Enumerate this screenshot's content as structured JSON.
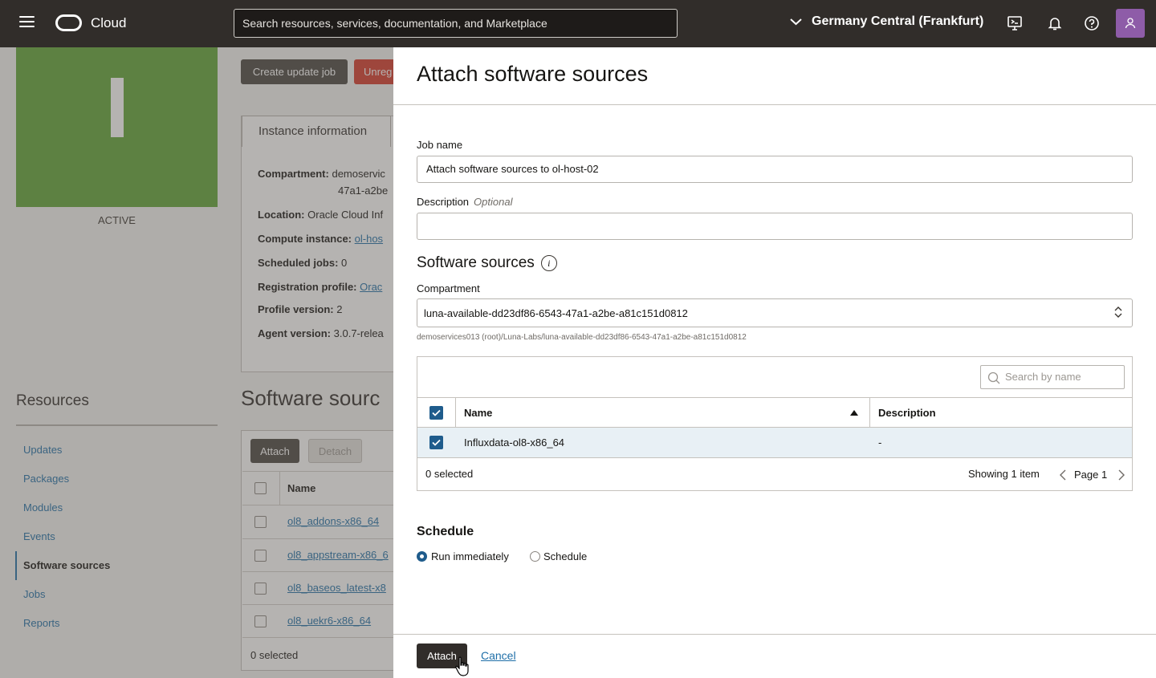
{
  "topbar": {
    "logo_text": "Cloud",
    "search_placeholder": "Search resources, services, documentation, and Marketplace",
    "region": "Germany Central (Frankfurt)"
  },
  "background": {
    "status": "ACTIVE",
    "buttons": {
      "create_update_job": "Create update job",
      "unregister": "Unreg"
    },
    "tab": "Instance information",
    "info": [
      {
        "label": "Compartment:",
        "value": "demoservic",
        "value2": "47a1-a2be"
      },
      {
        "label": "Location:",
        "value": "Oracle Cloud Inf"
      },
      {
        "label": "Compute instance:",
        "link": "ol-hos"
      },
      {
        "label": "Scheduled jobs:",
        "value": "0"
      },
      {
        "label": "Registration profile:",
        "link": "Orac"
      },
      {
        "label": "Profile version:",
        "value": "2"
      },
      {
        "label": "Agent version:",
        "value": "3.0.7-relea"
      }
    ],
    "resources_title": "Resources",
    "resources": [
      "Updates",
      "Packages",
      "Modules",
      "Events",
      "Software sources",
      "Jobs",
      "Reports"
    ],
    "resources_selected": "Software sources",
    "software_sources_title": "Software sourc",
    "attach_label": "Attach",
    "detach_label": "Detach",
    "name_header": "Name",
    "rows": [
      "ol8_addons-x86_64",
      "ol8_appstream-x86_6",
      "ol8_baseos_latest-x8",
      "ol8_uekr6-x86_64"
    ],
    "selected_count": "0 selected"
  },
  "panel": {
    "title": "Attach software sources",
    "job_name_label": "Job name",
    "job_name_value": "Attach software sources to ol-host-02",
    "description_label": "Description",
    "description_optional": "Optional",
    "description_value": "",
    "sources_title": "Software sources",
    "compartment_label": "Compartment",
    "compartment_value": "luna-available-dd23df86-6543-47a1-a2be-a81c151d0812",
    "compartment_path": "demoservices013 (root)/Luna-Labs/luna-available-dd23df86-6543-47a1-a2be-a81c151d0812",
    "table": {
      "search_placeholder": "Search by name",
      "headers": {
        "name": "Name",
        "description": "Description"
      },
      "rows": [
        {
          "name": "Influxdata-ol8-x86_64",
          "description": "-"
        }
      ],
      "selected_count": "0 selected",
      "showing": "Showing 1 item",
      "page": "Page 1"
    },
    "schedule_title": "Schedule",
    "schedule_options": {
      "immediate": "Run immediately",
      "later": "Schedule"
    },
    "schedule_selected": "Run immediately",
    "attach_button": "Attach",
    "cancel_link": "Cancel"
  },
  "colors": {
    "topbar": "#312d2a",
    "hero": "#5fa535",
    "accent": "#1f5c8c",
    "danger": "#d6392b",
    "avatar": "#8e5ca8"
  }
}
